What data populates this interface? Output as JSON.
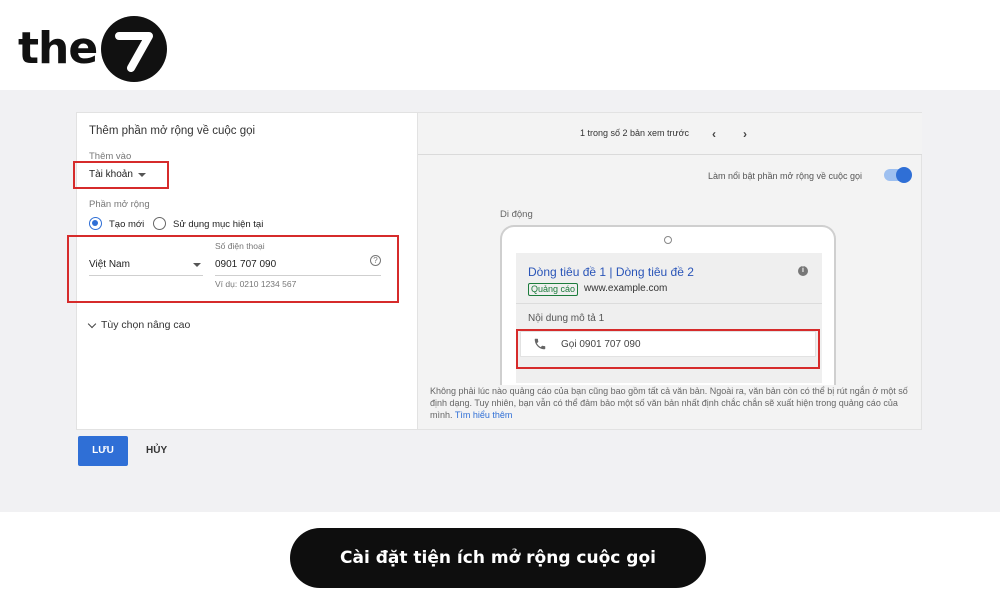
{
  "brand": {
    "logo_text": "the",
    "logo_mark": "7"
  },
  "form": {
    "title": "Thêm phần mở rộng về cuộc gọi",
    "add_to_label": "Thêm vào",
    "add_to_value": "Tài khoản",
    "extension_label": "Phần mở rộng",
    "radio_new": "Tạo mới",
    "radio_existing": "Sử dụng mục hiện tại",
    "country_value": "Việt Nam",
    "phone_label": "Số điện thoại",
    "phone_value": "0901 707 090",
    "phone_example": "Ví dụ: 0210 1234 567",
    "advanced_options": "Tùy chọn nâng cao",
    "save_label": "LƯU",
    "cancel_label": "HỦY"
  },
  "preview": {
    "pager_text": "1 trong số 2 bản xem trước",
    "prev_arrow": "‹",
    "next_arrow": "›",
    "highlight_label": "Làm nổi bật phần mở rộng về cuộc gọi",
    "highlight_on": true,
    "device_label": "Di động",
    "ad_title": "Dòng tiêu đề 1 | Dòng tiêu đề 2",
    "ad_badge": "Quảng cáo",
    "ad_url": "www.example.com",
    "ad_info_icon": "i",
    "ad_description": "Nội dung mô tả 1",
    "call_text": "Gọi 0901 707 090",
    "note_text": "Không phải lúc nào quảng cáo của bạn cũng bao gồm tất cả văn bản. Ngoài ra, văn bản còn có thể bị rút ngắn ở một số định dạng. Tuy nhiên, bạn vẫn có thể đảm bảo một số văn bản nhất định chắc chắn sẽ xuất hiện trong quảng cáo của mình.",
    "note_link": "Tìm hiểu thêm"
  },
  "caption": "Cài đặt tiện ích mở rộng cuộc gọi",
  "colors": {
    "accent": "#2f6fd6",
    "highlight_red": "#d62b2b",
    "caption_bg": "#0e0e0e"
  }
}
